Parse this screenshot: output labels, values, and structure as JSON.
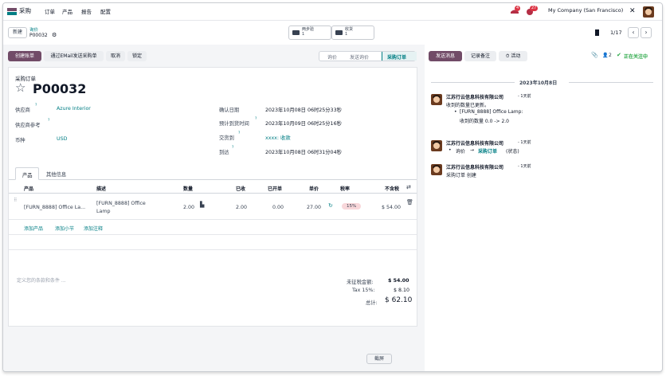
{
  "navbar": {
    "app_name": "采购",
    "menu": [
      "订单",
      "产品",
      "报告",
      "配置"
    ],
    "activity_count": "4",
    "chat_count": "27",
    "company": "My Company (San Francisco)"
  },
  "control": {
    "new_label": "新建",
    "breadcrumb_parent": "询价",
    "record_name": "P00032",
    "smart_buttons": [
      {
        "label": "两步验",
        "value": "1"
      },
      {
        "label": "收货",
        "value": "1"
      }
    ],
    "pager": "1/17"
  },
  "actions": {
    "create_bill": "创建账单",
    "send_email": "通过EMail发送采购单",
    "cancel": "取消",
    "lock": "锁定"
  },
  "statusbar": [
    "询价",
    "发送询价",
    "采购订单"
  ],
  "form": {
    "type_label": "采购订单",
    "name": "P00032",
    "vendor_label": "供应商",
    "vendor": "Azure Interior",
    "vendor_ref_label": "供应商参考",
    "currency_label": "币种",
    "currency": "USD",
    "confirm_date_label": "确认日期",
    "confirm_date": "2023年10月08日 06时25分33秒",
    "expected_arrival_label": "预计到货时间",
    "expected_arrival": "2023年10月09日 06时25分16秒",
    "deliver_to_label": "交货到",
    "deliver_to": "xxxx: 收款",
    "arrival_label": "到达",
    "arrival": "2023年10月08日 06时31分04秒"
  },
  "tabs": [
    "产品",
    "其他信息"
  ],
  "table": {
    "headers": [
      "产品",
      "描述",
      "数量",
      "已收",
      "已开单",
      "单价",
      "税率",
      "不含税"
    ],
    "rows": [
      {
        "product": "[FURN_8888] Office La...",
        "description_1": "[FURN_8888] Office",
        "description_2": "Lamp",
        "qty": "2.00",
        "received": "2.00",
        "billed": "0.00",
        "price": "27.00",
        "tax": "15%",
        "subtotal": "$ 54.00"
      }
    ],
    "add_product": "添加产品",
    "add_section": "添加小节",
    "add_note": "添加注释"
  },
  "terms_placeholder": "定义您的条款和条件 ...",
  "totals": {
    "untaxed_label": "未征税金额:",
    "untaxed": "$ 54.00",
    "tax_label": "Tax 15%:",
    "tax": "$ 8.10",
    "total_label": "总计:",
    "total": "$ 62.10"
  },
  "chatter": {
    "send_message": "发送消息",
    "log_note": "记录备注",
    "activities": "活动",
    "attachments_count": "0",
    "followers_count": "2",
    "following": "正在关注中",
    "date_separator": "2023年10月8日",
    "messages": [
      {
        "author": "江苏行云信息科技有限公司",
        "time": "- 1天前",
        "text": "收到的数量已更新。",
        "bullet_1": "[FURN_8888] Office Lamp:",
        "bullet_2": "收到的数量 0.0 -> 2.0"
      },
      {
        "author": "江苏行云信息科技有限公司",
        "time": "- 1天前",
        "change_from": "询价",
        "change_to": "采购订单",
        "change_field": "(状态)"
      },
      {
        "author": "江苏行云信息科技有限公司",
        "time": "- 1天前",
        "text": "采购订单 创建"
      }
    ]
  },
  "footer_button": "截屏",
  "colors": {
    "primary": "#714b67",
    "link": "#017e84",
    "follow": "#28a745"
  }
}
